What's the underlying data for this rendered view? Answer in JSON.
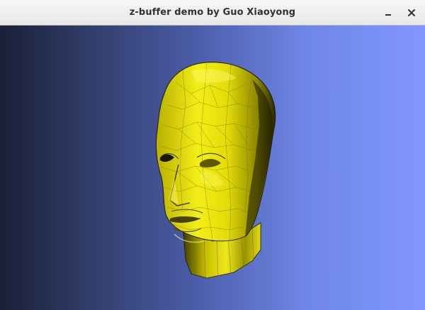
{
  "window": {
    "title": "z-buffer demo by Guo Xiaoyong",
    "minimize_glyph": "minimize-icon",
    "close_glyph": "close-icon"
  },
  "scene": {
    "model": "head-mesh",
    "mesh_color": "#e8e000",
    "background_left": "#1a1f36",
    "background_right": "#8197ff"
  }
}
